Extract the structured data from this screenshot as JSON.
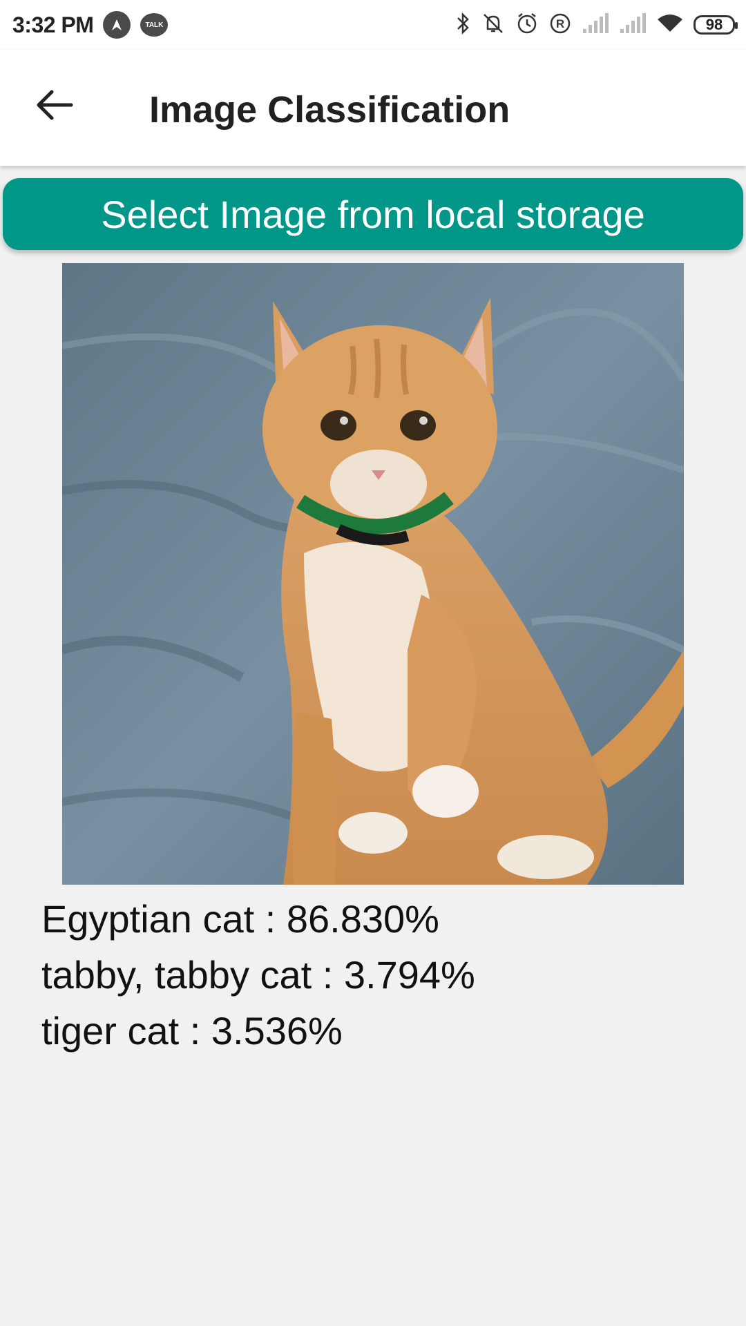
{
  "status_bar": {
    "time": "3:32 PM",
    "talk_label": "TALK",
    "battery": "98",
    "icons": [
      "navigation-icon",
      "talk-icon",
      "bluetooth-icon",
      "vibrate-off-icon",
      "alarm-icon",
      "registered-icon",
      "signal-icon",
      "signal-icon",
      "wifi-icon",
      "battery-icon"
    ]
  },
  "app_bar": {
    "back_icon": "arrow-back-icon",
    "title": "Image Classification"
  },
  "main": {
    "select_button_label": "Select Image from local storage",
    "image_subject": "orange tabby kitten",
    "results": [
      "Egyptian cat : 86.830%",
      "tabby, tabby cat : 3.794%",
      "tiger cat : 3.536%"
    ]
  },
  "colors": {
    "accent": "#009688",
    "background": "#f1f1f1",
    "app_bar": "#ffffff"
  }
}
